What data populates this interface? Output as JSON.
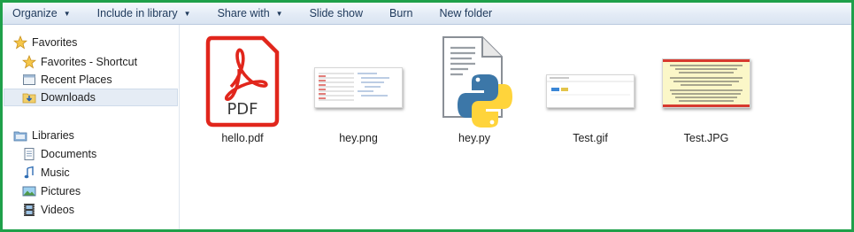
{
  "toolbar": {
    "organize": "Organize",
    "include_in_library": "Include in library",
    "share_with": "Share with",
    "slide_show": "Slide show",
    "burn": "Burn",
    "new_folder": "New folder"
  },
  "sidebar": {
    "favorites": "Favorites",
    "favorites_shortcut": "Favorites - Shortcut",
    "recent_places": "Recent Places",
    "downloads": "Downloads",
    "libraries": "Libraries",
    "documents": "Documents",
    "music": "Music",
    "pictures": "Pictures",
    "videos": "Videos"
  },
  "files": [
    {
      "name": "hello.pdf",
      "icon": "pdf-file-icon",
      "badge": "PDF"
    },
    {
      "name": "hey.png",
      "icon": "png-thumbnail"
    },
    {
      "name": "hey.py",
      "icon": "python-file-icon"
    },
    {
      "name": "Test.gif",
      "icon": "gif-thumbnail"
    },
    {
      "name": "Test.JPG",
      "icon": "jpg-thumbnail"
    }
  ],
  "colors": {
    "frame_border": "#1fa04a",
    "pdf_red": "#e1261c",
    "python_blue": "#3c77a8",
    "python_yellow": "#ffd43b",
    "selected_row": "#e5ecf5"
  }
}
